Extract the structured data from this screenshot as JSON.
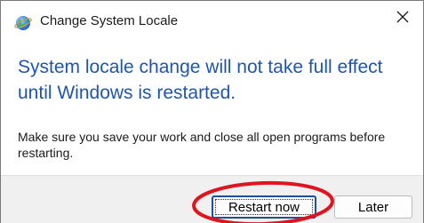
{
  "window": {
    "title": "Change System Locale",
    "app_icon": "globe-icon",
    "close_icon": "close-icon"
  },
  "content": {
    "instruction": "System locale change will not take full effect until Windows is restarted.",
    "body": "Make sure you save your work and close all open programs before restarting."
  },
  "buttons": {
    "restart_now": "Restart now",
    "later": "Later"
  },
  "colors": {
    "instruction_text": "#1e55b3",
    "highlight_annotation": "#e0141e",
    "default_button_border": "#1c4f9c"
  }
}
